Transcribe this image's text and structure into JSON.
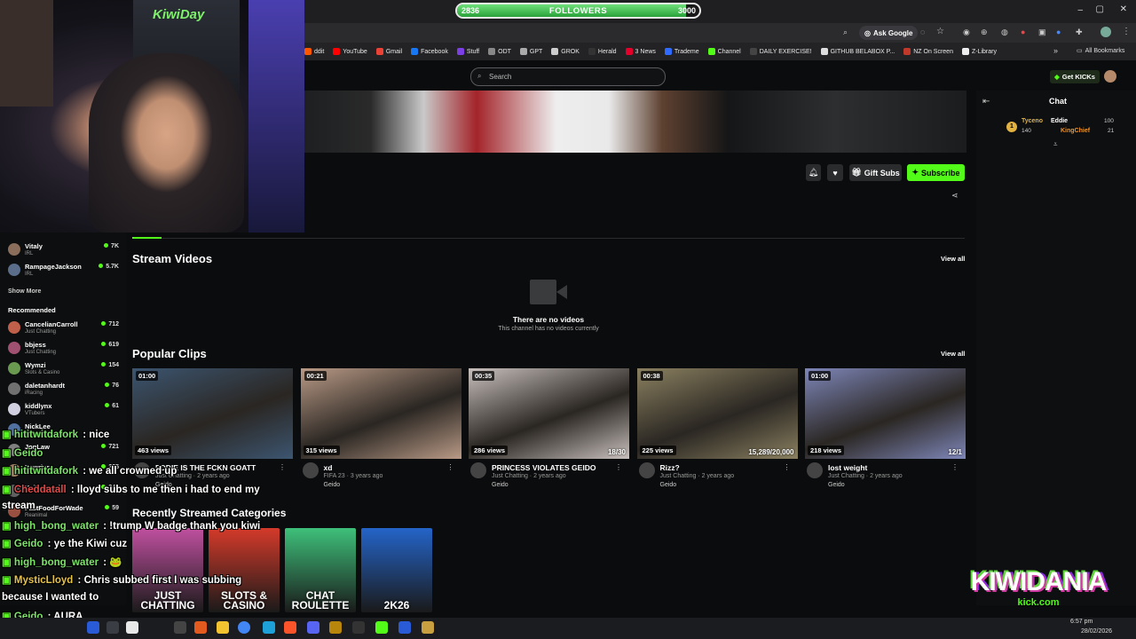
{
  "overlay": {
    "followers_current": "2836",
    "followers_label": "FOLLOWERS",
    "followers_goal": "3000",
    "followers_fraction": 0.946,
    "logo_text": "KIWIDANIA",
    "logo_sub": "kick.com",
    "cam_text": "KiwiDay"
  },
  "browser": {
    "ask_google": "Ask Google",
    "bookmarks": [
      {
        "label": "ddit",
        "color": "#ff5700"
      },
      {
        "label": "YouTube",
        "color": "#ff0000"
      },
      {
        "label": "Gmail",
        "color": "#ea4335"
      },
      {
        "label": "Facebook",
        "color": "#1877f2"
      },
      {
        "label": "Stuff",
        "color": "#7b3fe4"
      },
      {
        "label": "ODT",
        "color": "#888888"
      },
      {
        "label": "GPT",
        "color": "#aaaaaa"
      },
      {
        "label": "GROK",
        "color": "#cccccc"
      },
      {
        "label": "Herald",
        "color": "#333333"
      },
      {
        "label": "3 News",
        "color": "#e4002b"
      },
      {
        "label": "Trademe",
        "color": "#2f6bff"
      },
      {
        "label": "Channel",
        "color": "#53fc18"
      },
      {
        "label": "DAILY EXERCISE!",
        "color": "#444444"
      },
      {
        "label": "GITHUB BELABOX P...",
        "color": "#dddddd"
      },
      {
        "label": "NZ On Screen",
        "color": "#c0392b"
      },
      {
        "label": "Z-Library",
        "color": "#eeeeee"
      }
    ],
    "all_bookmarks": "All Bookmarks"
  },
  "kick": {
    "search_placeholder": "Search",
    "get_kicks": "Get KICKs",
    "gift_subs": "Gift Subs",
    "subscribe": "Subscribe",
    "chat_title": "Chat",
    "chat_top": [
      {
        "name": "Tyceno",
        "value": "140",
        "color": "#e3b341"
      },
      {
        "name": "Eddie",
        "value": "100",
        "color": "#ffffff"
      },
      {
        "name": "KingChief",
        "value": "21",
        "color": "#f0932b"
      }
    ],
    "stream_videos": "Stream Videos",
    "view_all": "View all",
    "no_videos_title": "There are no videos",
    "no_videos_sub": "This channel has no videos currently",
    "popular_clips": "Popular Clips",
    "clips": [
      {
        "duration": "01:00",
        "views": "463 views",
        "title": "EDDIE IS THE FCKN GOATT",
        "meta": "Just Chatting · 2 years ago",
        "channel": "Geido",
        "extra": "",
        "bg": "#3c5570"
      },
      {
        "duration": "00:21",
        "views": "315 views",
        "title": "xd",
        "meta": "FIFA 23 · 3 years ago",
        "channel": "Geido",
        "extra": "",
        "bg": "#b99a86"
      },
      {
        "duration": "00:35",
        "views": "286 views",
        "title": "PRINCESS VIOLATES GEIDO",
        "meta": "Just Chatting · 2 years ago",
        "channel": "Geido",
        "extra": "18/30",
        "bg": "#c8c0bc"
      },
      {
        "duration": "00:38",
        "views": "225 views",
        "title": "Rizz?",
        "meta": "Just Chatting · 2 years ago",
        "channel": "Geido",
        "extra": "15,289/20,000",
        "bg": "#8a8060"
      },
      {
        "duration": "01:00",
        "views": "218 views",
        "title": "lost weight",
        "meta": "Just Chatting · 2 years ago",
        "channel": "Geido",
        "extra": "12/1",
        "bg": "#7e86b8"
      }
    ],
    "recent_categories": "Recently Streamed Categories",
    "categories": [
      {
        "label": "JUST CHATTING",
        "bg": "#c050a0"
      },
      {
        "label": "SLOTS & CASINO",
        "bg": "#d43a2a"
      },
      {
        "label": "CHAT ROULETTE",
        "bg": "#3ec07a"
      },
      {
        "label": "2K26",
        "bg": "#2464c8"
      }
    ]
  },
  "sidebar": {
    "following": [
      {
        "name": "Vitaly",
        "sub": "IRL",
        "count": "7K",
        "color": "#8a6d5a"
      },
      {
        "name": "RampageJackson",
        "sub": "IRL",
        "count": "5.7K",
        "color": "#5a6d8a"
      }
    ],
    "show_more": "Show More",
    "recommended_title": "Recommended",
    "recommended": [
      {
        "name": "CancelianCarroll",
        "sub": "Just Chatting",
        "count": "712",
        "color": "#c0604a"
      },
      {
        "name": "bbjess",
        "sub": "Just Chatting",
        "count": "619",
        "color": "#a05070"
      },
      {
        "name": "Wymzi",
        "sub": "Slots & Casino",
        "count": "154",
        "color": "#6a9a50"
      },
      {
        "name": "daletanhardt",
        "sub": "iRacing",
        "count": "76",
        "color": "#707070"
      },
      {
        "name": "kiddlynx",
        "sub": "VTubers",
        "count": "61",
        "color": "#d0d0e0"
      },
      {
        "name": "NickLee",
        "sub": "",
        "count": "",
        "color": "#5070a0"
      },
      {
        "name": "JonLaw",
        "sub": "",
        "count": "721",
        "color": "#808080"
      },
      {
        "name": "Powdur",
        "sub": "",
        "count": "265",
        "color": "#a08060"
      },
      {
        "name": "Keithsmvein",
        "sub": "",
        "count": "344",
        "color": "#606060"
      },
      {
        "name": "FastFoodForWade",
        "sub": "Reanimal",
        "count": "59",
        "color": "#9a5040"
      }
    ]
  },
  "chat_overlay": [
    {
      "user": "hititwitdafork",
      "text": " : nice",
      "color": "#7ee36b"
    },
    {
      "user": "Geido",
      "text": "",
      "color": "#7ee36b"
    },
    {
      "user": "hititwitdafork",
      "text": " : we all crowned up",
      "color": "#7ee36b"
    },
    {
      "user": "Cheddatall",
      "text": " : lloyd subs to me then i had to end my",
      "color": "#e04848"
    },
    {
      "user": "",
      "text": "stream",
      "color": "#ffffff"
    },
    {
      "user": "high_bong_water",
      "text": " : !trump W badge thank you kiwi",
      "color": "#7ee36b"
    },
    {
      "user": "Geido",
      "text": " : ye the Kiwi cuz",
      "color": "#7ee36b"
    },
    {
      "user": "high_bong_water",
      "text": " : 🐸",
      "color": "#7ee36b"
    },
    {
      "user": "MysticLloyd",
      "text": " : Chris subbed first I was subbing",
      "color": "#e6c24a"
    },
    {
      "user": "",
      "text": "because I wanted to",
      "color": "#ffffff"
    },
    {
      "user": "Geido",
      "text": " : AURA",
      "color": "#7ee36b"
    }
  ],
  "taskbar": {
    "time": "6:57 pm",
    "date": "28/02/2026"
  }
}
